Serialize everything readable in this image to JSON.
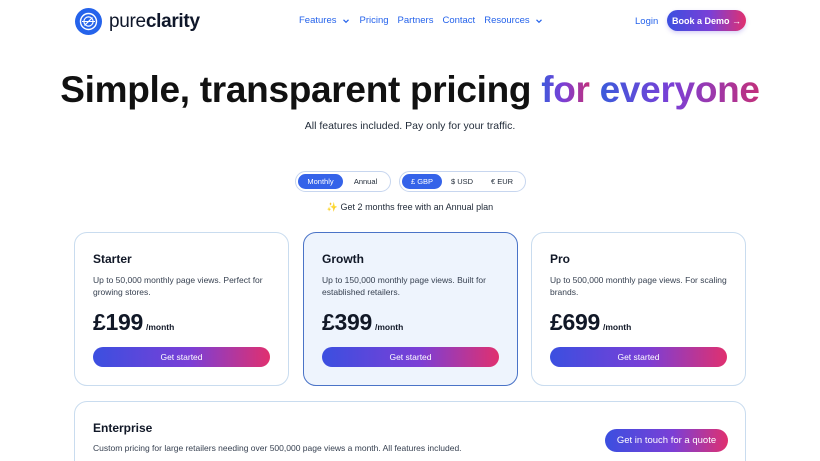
{
  "brand": {
    "name_light": "pure",
    "name_bold": "clarity",
    "logo_icon": "pureclarity-logo-icon"
  },
  "nav": {
    "items": [
      {
        "label": "Features",
        "has_dropdown": true
      },
      {
        "label": "Pricing",
        "has_dropdown": false
      },
      {
        "label": "Partners",
        "has_dropdown": false
      },
      {
        "label": "Contact",
        "has_dropdown": false
      },
      {
        "label": "Resources",
        "has_dropdown": true
      }
    ],
    "login_label": "Login",
    "demo_label": "Book a Demo →"
  },
  "hero": {
    "title_plain": "Simple, transparent pricing ",
    "title_for": "for",
    "title_everyone": "everyone",
    "subtitle": "All features included. Pay only for your traffic."
  },
  "billing_toggle": {
    "options": [
      "Monthly",
      "Annual"
    ],
    "selected": "Monthly"
  },
  "currency_toggle": {
    "options": [
      "£ GBP",
      "$ USD",
      "€ EUR"
    ],
    "selected": "£ GBP"
  },
  "promo": "✨ Get 2 months free with an Annual plan",
  "plans": [
    {
      "name": "Starter",
      "description": "Up to 50,000 monthly page views. Perfect for growing stores.",
      "price": "£199",
      "unit": "/month",
      "cta": "Get started",
      "highlighted": false
    },
    {
      "name": "Growth",
      "description": "Up to 150,000 monthly page views. Built for established retailers.",
      "price": "£399",
      "unit": "/month",
      "cta": "Get started",
      "highlighted": true
    },
    {
      "name": "Pro",
      "description": "Up to 500,000 monthly page views. For scaling brands.",
      "price": "£699",
      "unit": "/month",
      "cta": "Get started",
      "highlighted": false
    }
  ],
  "enterprise": {
    "name": "Enterprise",
    "description": "Custom pricing for large retailers needing over 500,000 page views a month. All features included.",
    "cta": "Get in touch for a quote"
  },
  "colors": {
    "accent_blue": "#2563eb",
    "toggle_active": "#3563e9",
    "gradient_start": "#3b4fe0",
    "gradient_mid": "#7b3fd6",
    "gradient_end": "#e0306f",
    "highlight_card_bg": "#eef4fd"
  }
}
